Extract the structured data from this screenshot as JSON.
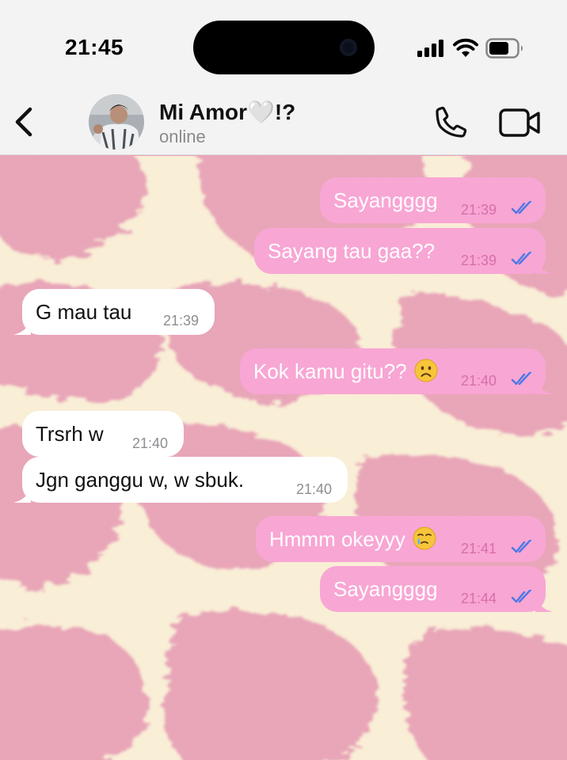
{
  "status_bar": {
    "time": "21:45"
  },
  "header": {
    "contact_name": "Mi Amor🤍!?",
    "contact_status": "online"
  },
  "messages": [
    {
      "direction": "out",
      "text": "Sayangggg",
      "time": "21:39",
      "read": true
    },
    {
      "direction": "out",
      "text": "Sayang tau gaa??",
      "time": "21:39",
      "read": true
    },
    {
      "direction": "in",
      "text": "G mau tau",
      "time": "21:39"
    },
    {
      "direction": "out",
      "text": "Kok kamu gitu??",
      "emoji": "frowning-face",
      "time": "21:40",
      "read": true
    },
    {
      "direction": "in",
      "text": "Trsrh w",
      "time": "21:40"
    },
    {
      "direction": "in",
      "text": "Jgn ganggu w, w sbuk.",
      "time": "21:40"
    },
    {
      "direction": "out",
      "text": "Hmmm okeyyy",
      "emoji": "face-holding-back-tears",
      "time": "21:41",
      "read": true
    },
    {
      "direction": "out",
      "text": "Sayangggg",
      "time": "21:44",
      "read": true
    }
  ],
  "colors": {
    "outgoing_bubble": "#f8a6d4",
    "incoming_bubble": "#ffffff",
    "read_ticks": "#4a79e6",
    "wallpaper_pink": "#e9a2b4",
    "wallpaper_cream": "#fbf4d8"
  }
}
